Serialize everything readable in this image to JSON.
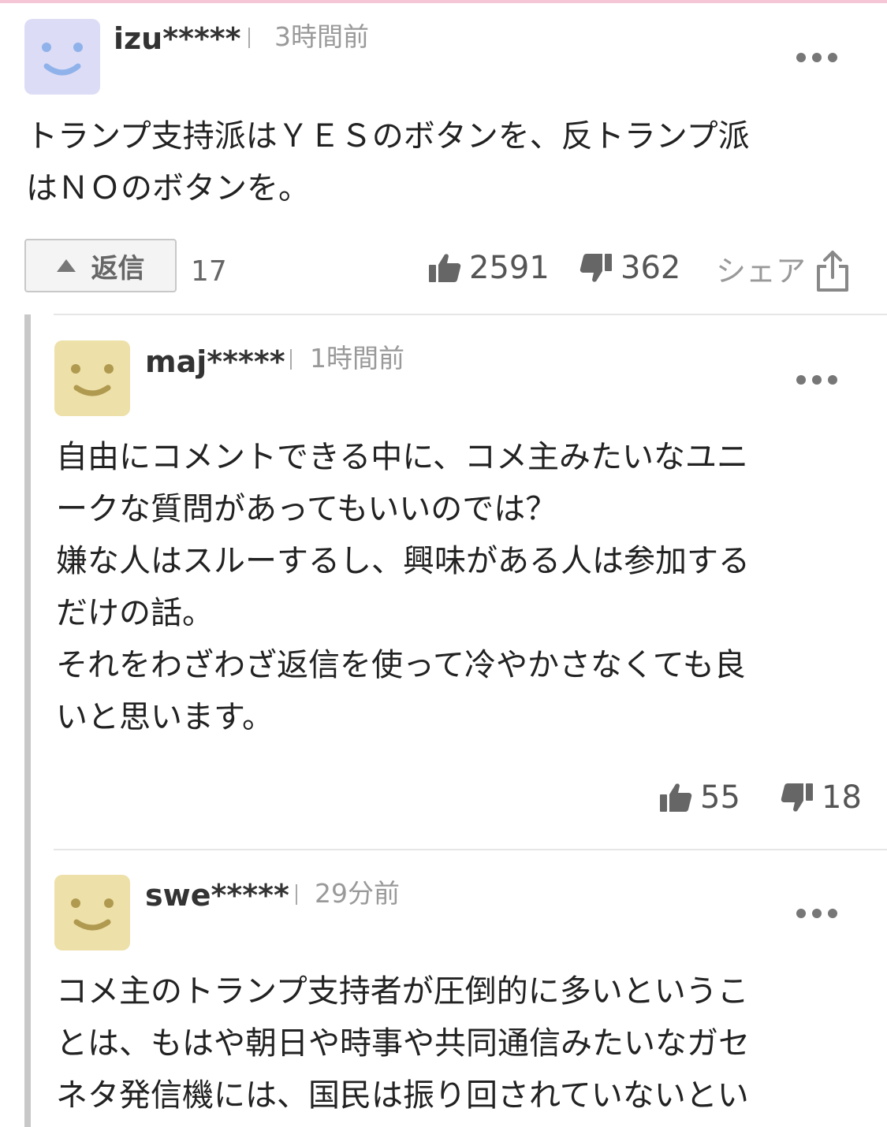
{
  "comments": [
    {
      "username": "izu*****",
      "time": "3時間前",
      "avatar_color": "#dcdcf6",
      "avatar_face_color": "#8fb2ea",
      "avatar_icon": "smiley-face-icon",
      "text": "トランプ支持派はＹＥＳのボタンを、反トランプ派\nはＮＯのボタンを。",
      "reply_label": "返信",
      "reply_count": "17",
      "likes": "2591",
      "dislikes": "362",
      "share_label": "シェア"
    }
  ],
  "replies": [
    {
      "username": "maj*****",
      "time": "1時間前",
      "avatar_color": "#ede0a8",
      "avatar_face_color": "#b09a50",
      "avatar_icon": "smiley-face-icon",
      "text": "自由にコメントできる中に、コメ主みたいなユニ\nークな質問があってもいいのでは？\n嫌な人はスルーするし、興味がある人は参加する\nだけの話。\nそれをわざわざ返信を使って冷やかさなくても良\nいと思います。",
      "likes": "55",
      "dislikes": "18"
    },
    {
      "username": "swe*****",
      "time": "29分前",
      "avatar_color": "#ede0a8",
      "avatar_face_color": "#b09a50",
      "avatar_icon": "smiley-face-icon",
      "text": "コメ主のトランプ支持者が圧倒的に多いというこ\nとは、もはや朝日や時事や共同通信みたいなガセ\nネタ発信機には、国民は振り回されていないとい"
    }
  ]
}
